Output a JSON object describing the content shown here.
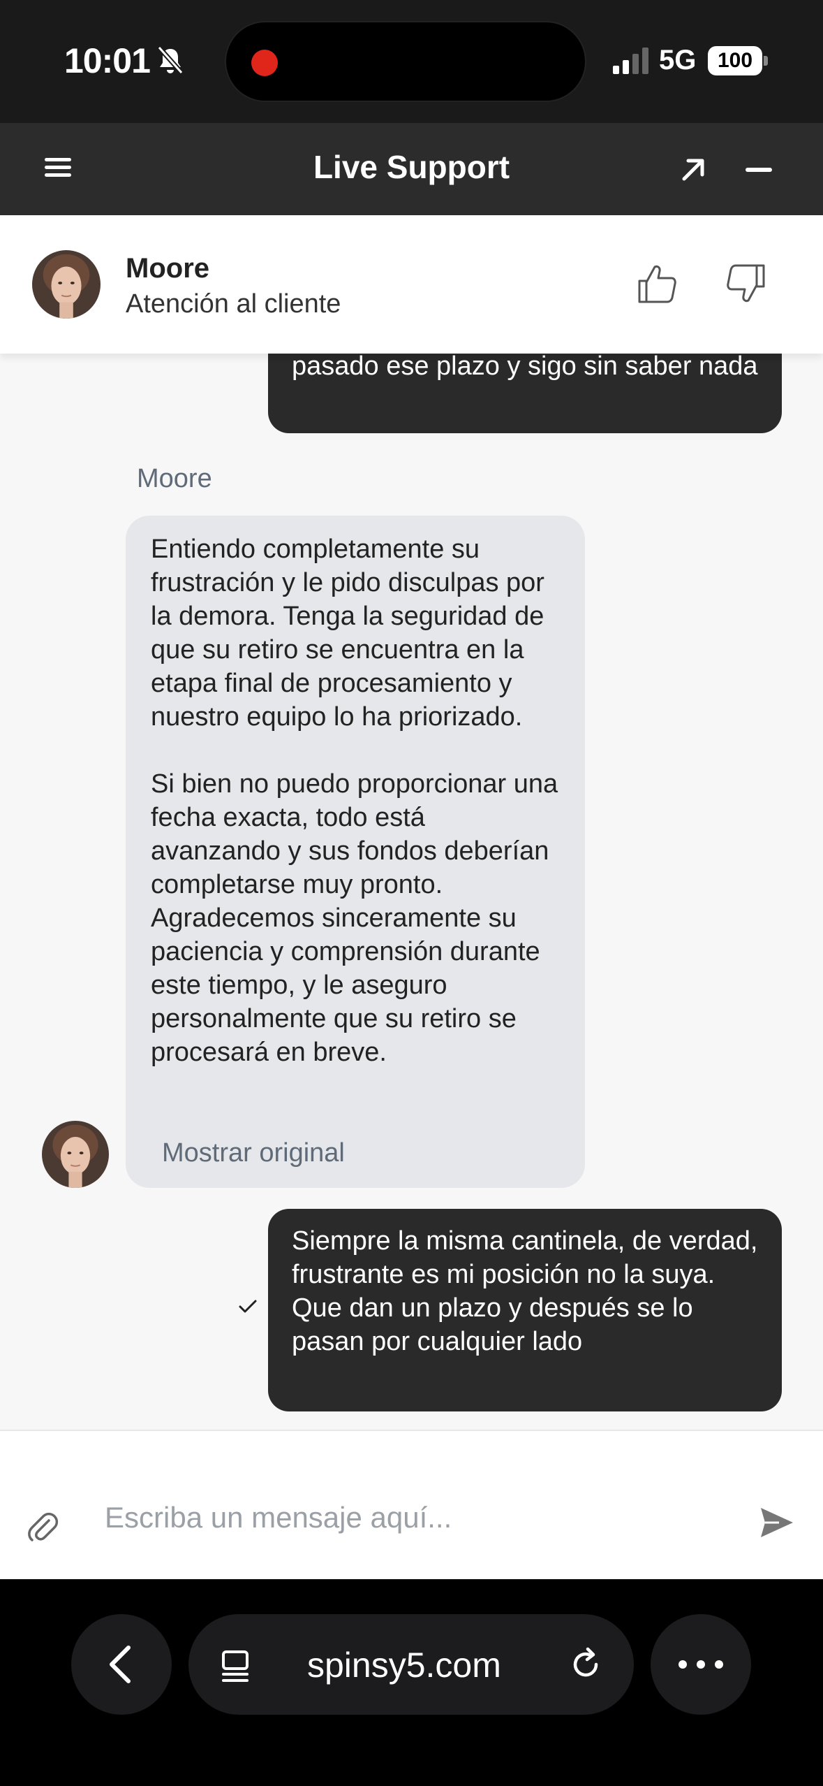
{
  "status_bar": {
    "time": "10:01",
    "network": "5G",
    "battery": "100",
    "icons": [
      "bell-slash-icon",
      "recording-dot-icon",
      "signal-icon"
    ]
  },
  "header": {
    "title": "Live Support",
    "icons": [
      "menu-icon",
      "expand-icon",
      "minimize-icon"
    ]
  },
  "agent": {
    "name": "Moore",
    "role": "Atención al cliente",
    "icons": [
      "thumbs-up-icon",
      "thumbs-down-icon"
    ]
  },
  "chat": {
    "messages": [
      {
        "from": "user",
        "text": "pasado ese plazo y sigo sin saber nada"
      },
      {
        "from": "agent",
        "sender": "Moore",
        "paragraphs": [
          "Entiendo completamente su frustración y le pido disculpas por la demora. Tenga la seguridad de que su retiro se encuentra en la etapa final de procesamiento y nuestro equipo lo ha priorizado.",
          "Si bien no puedo proporcionar una fecha exacta, todo está avanzando y sus fondos deberían completarse muy pronto. Agradecemos sinceramente su paciencia y comprensión durante este tiempo, y le aseguro personalmente que su retiro se procesará en breve."
        ],
        "show_original": "Mostrar original"
      },
      {
        "from": "user",
        "text": "Siempre la misma cantinela, de verdad, frustrante es mi posición no la suya. Que dan un plazo y después se lo pasan por cualquier lado",
        "status_icon": "checkmark-icon"
      }
    ]
  },
  "composer": {
    "placeholder": "Escriba un mensaje aquí...",
    "value": "",
    "icons": [
      "paperclip-icon",
      "send-icon"
    ]
  },
  "browser": {
    "domain": "spinsy5.com",
    "icons": [
      "back-icon",
      "tabs-icon",
      "reload-icon",
      "more-icon"
    ]
  },
  "colors": {
    "header_bg": "#2c2c2c",
    "outgoing_bubble": "#2a2a2a",
    "incoming_bubble": "#e6e7ea",
    "chat_bg": "#f7f7f8",
    "recording_dot": "#e0251b"
  }
}
